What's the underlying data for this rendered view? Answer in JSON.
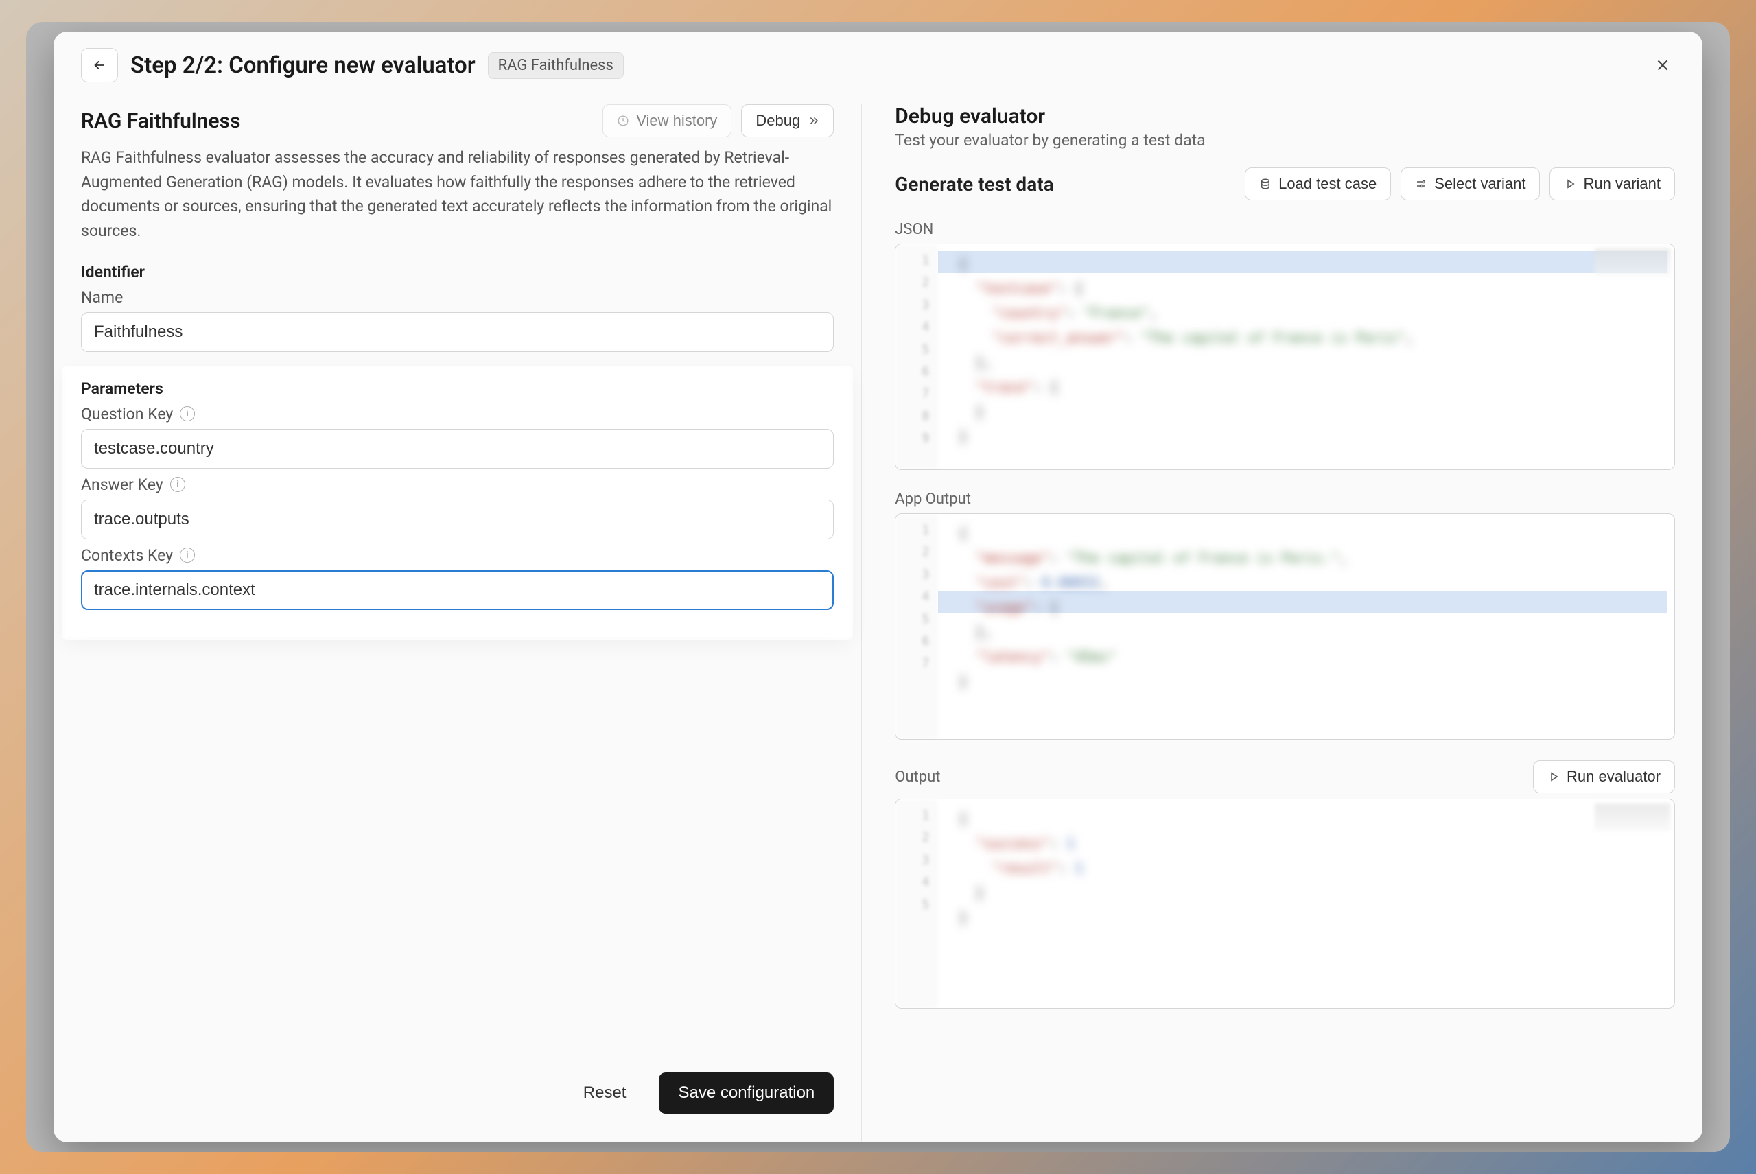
{
  "header": {
    "step_title": "Step 2/2:  Configure new evaluator",
    "tag": "RAG Faithfulness"
  },
  "left": {
    "title": "RAG Faithfulness",
    "view_history": "View history",
    "debug": "Debug",
    "description": "RAG Faithfulness evaluator assesses the accuracy and reliability of responses generated by Retrieval-Augmented Generation (RAG) models. It evaluates how faithfully the responses adhere to the retrieved documents or sources, ensuring that the generated text accurately reflects the information from the original sources.",
    "identifier_label": "Identifier",
    "name_label": "Name",
    "name_value": "Faithfulness",
    "parameters_label": "Parameters",
    "question_key_label": "Question Key",
    "question_key_value": "testcase.country",
    "answer_key_label": "Answer Key",
    "answer_key_value": "trace.outputs",
    "contexts_key_label": "Contexts Key",
    "contexts_key_value": "trace.internals.context",
    "reset": "Reset",
    "save": "Save configuration"
  },
  "right": {
    "title": "Debug evaluator",
    "subtitle": "Test your evaluator by generating a test data",
    "generate_label": "Generate test data",
    "load_test_case": "Load test case",
    "select_variant": "Select variant",
    "run_variant": "Run variant",
    "json_label": "JSON",
    "app_output_label": "App Output",
    "output_label": "Output",
    "run_evaluator": "Run evaluator"
  }
}
